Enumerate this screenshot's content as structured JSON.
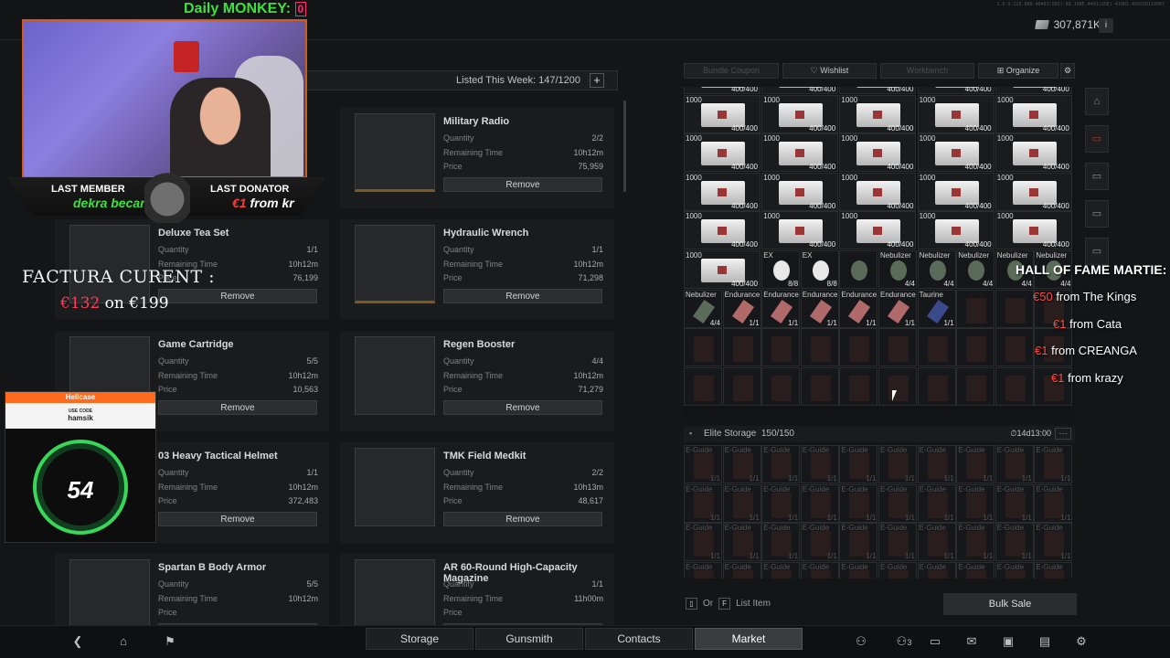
{
  "build": "1.0.0.129.000.40401(UOS)-89.1085.4401(USE)-41001.40201R110007",
  "balance": "307,871K",
  "listed_label": "Listed This Week: 147/1200",
  "offer_fields": {
    "qty": "Quantity",
    "time": "Remaining Time",
    "price": "Price",
    "remove": "Remove"
  },
  "offers": [
    {
      "name": "Military Radio",
      "qty": "2/2",
      "time": "10h12m",
      "price": "75,959"
    },
    {
      "name": "Deluxe Tea Set",
      "qty": "1/1",
      "time": "10h12m",
      "price": "76,199"
    },
    {
      "name": "Hydraulic Wrench",
      "qty": "1/1",
      "time": "10h12m",
      "price": "71,298"
    },
    {
      "name": "Game Cartridge",
      "qty": "5/5",
      "time": "10h12m",
      "price": "10,563"
    },
    {
      "name": "Regen Booster",
      "qty": "4/4",
      "time": "10h12m",
      "price": "71,279"
    },
    {
      "name": "03 Heavy Tactical Helmet",
      "qty": "1/1",
      "time": "10h12m",
      "price": "372,483"
    },
    {
      "name": "TMK Field Medkit",
      "qty": "2/2",
      "time": "10h13m",
      "price": "48,617"
    },
    {
      "name": "Spartan B Body Armor",
      "qty": "5/5",
      "time": "10h12m",
      "price": ""
    },
    {
      "name": "AR 60-Round High-Capacity Magazine",
      "qty": "1/1",
      "time": "11h00m",
      "price": ""
    }
  ],
  "stash_toolbar": {
    "bundle": "Bundle Coupon",
    "wishlist": "Wishlist",
    "workbench": "Workbench",
    "organize": "Organize"
  },
  "stash": {
    "card_label": "1000",
    "card_count": "400/400",
    "ex_label": "EX",
    "ex_count": "8/8",
    "nebulizer": "Nebulizer",
    "nebulizer_count": "4/4",
    "endurance": "Endurance",
    "endurance_count": "1/1",
    "taurine": "Taurine",
    "taurine_count": "1/1",
    "empty_label": "E-Guide",
    "empty_count": "1/1"
  },
  "elite": {
    "title": "Elite Storage",
    "count": "150/150",
    "time": "14d13:00",
    "more": "···"
  },
  "or_list": {
    "or": "Or",
    "key": "F",
    "label": "List Item"
  },
  "bulk_sale": "Bulk Sale",
  "nav_tabs": [
    "Storage",
    "Gunsmith",
    "Contacts",
    "Market"
  ],
  "nav_active": "Market",
  "nav_badge": "3",
  "overlay": {
    "daily": "Daily MONKEY:",
    "daily_count": "0",
    "last_member_title": "LAST MEMBER",
    "last_member_name": "dekra becam",
    "last_donator_title": "LAST DONATOR",
    "last_donator_amount": "€1",
    "last_donator_from": " from kr",
    "factura_title": "FACTURA CURENT :",
    "factura_current": "€132",
    "factura_on": " on €199",
    "hellcase_brand": "Hellcase",
    "hellcase_use_code": "USE CODE",
    "hellcase_code": "hamsik",
    "hellcase_number": "54",
    "hof_title": "HALL OF FAME MARTIE:",
    "hof_entries": [
      {
        "amount": "€50",
        "from": " from The Kings"
      },
      {
        "amount": "€1",
        "from": " from Cata"
      },
      {
        "amount": "€1",
        "from": " from CREANGA"
      },
      {
        "amount": "€1",
        "from": " from krazy"
      }
    ]
  },
  "colors": {
    "accent_red": "#b43b2f",
    "green_overlay": "#3ee03e",
    "hellcase_orange": "#ff6a1f"
  }
}
